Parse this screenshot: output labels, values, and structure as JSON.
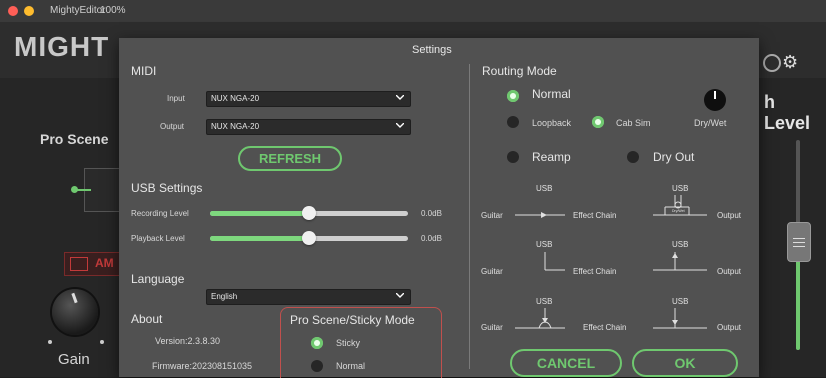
{
  "window": {
    "title": "MightyEditor",
    "zoom": "100%",
    "close_color": "#ff5f57",
    "minimize_color": "#febc2e"
  },
  "background_app": {
    "brand": "MIGHT",
    "pro_scene": "Pro Scene",
    "right_label": "h Level",
    "amp_label": "AM",
    "gain_label": "Gain"
  },
  "dialog": {
    "title": "Settings",
    "midi": {
      "header": "MIDI",
      "input_label": "Input",
      "input_value": "NUX NGA-20",
      "output_label": "Output",
      "output_value": "NUX NGA-20",
      "refresh_label": "REFRESH"
    },
    "usb": {
      "header": "USB Settings",
      "recording_label": "Recording Level",
      "recording_value": "0.0dB",
      "recording_fraction": 0.5,
      "playback_label": "Playback Level",
      "playback_value": "0.0dB",
      "playback_fraction": 0.5
    },
    "language": {
      "header": "Language",
      "value": "English"
    },
    "about": {
      "header": "About",
      "version": "Version:2.3.8.30",
      "firmware": "Firmware:202308151035"
    },
    "pro_scene_mode": {
      "header": "Pro Scene/Sticky Mode",
      "options": [
        {
          "label": "Sticky",
          "selected": true
        },
        {
          "label": "Normal",
          "selected": false
        }
      ]
    },
    "routing": {
      "header": "Routing Mode",
      "normal": "Normal",
      "loopback": "Loopback",
      "cab_sim": "Cab Sim",
      "dry_wet": "Dry/Wet",
      "reamp": "Reamp",
      "dry_out": "Dry Out",
      "diagram": {
        "usb": "USB",
        "guitar": "Guitar",
        "effect_chain": "Effect Chain",
        "output": "Output",
        "drywet_small": "Dry/Wet"
      }
    },
    "cancel_label": "CANCEL",
    "ok_label": "OK",
    "accent_color": "#6fc86f",
    "highlight_color": "#c0504d"
  }
}
